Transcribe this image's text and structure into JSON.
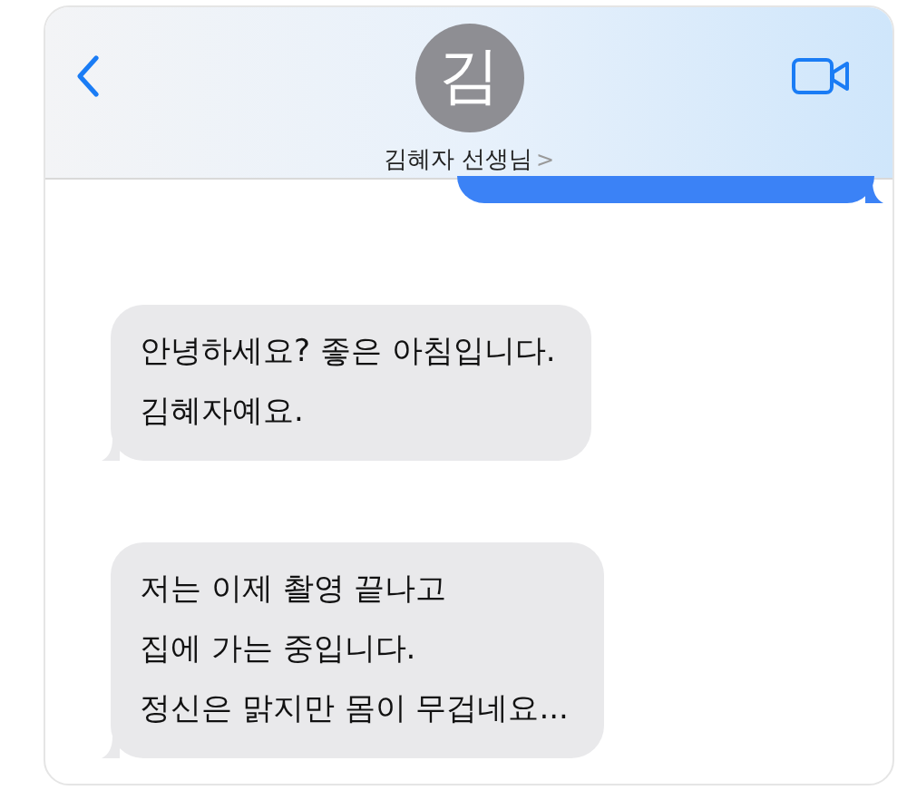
{
  "header": {
    "avatar_initial": "김",
    "contact_name": "김혜자 선생님",
    "name_chevron": ">"
  },
  "messages": [
    {
      "kind": "sent"
    },
    {
      "kind": "received",
      "text": "안녕하세요? 좋은 아침입니다.\n김혜자예요."
    },
    {
      "kind": "received",
      "text": "저는 이제 촬영 끝나고\n집에 가는 중입니다.\n정신은 맑지만 몸이 무겁네요..."
    }
  ]
}
